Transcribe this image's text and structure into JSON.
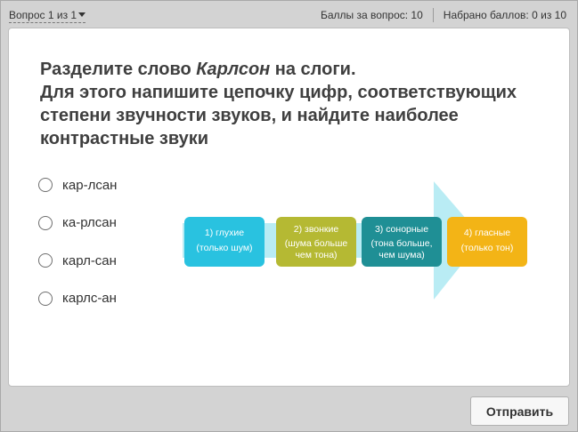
{
  "header": {
    "question_nav": "Вопрос 1 из 1",
    "points_per_question": "Баллы за вопрос: 10",
    "points_scored": "Набрано баллов: 0 из 10"
  },
  "question": {
    "line1_prefix": "Разделите слово ",
    "line1_word": "Карлсон",
    "line1_suffix": " на слоги.",
    "line2": "Для этого напишите цепочку цифр, соответствующих степени звучности звуков, и найдите наиболее контрастные звуки"
  },
  "options": [
    {
      "label": "кар-лсан"
    },
    {
      "label": "ка-рлсан"
    },
    {
      "label": "карл-сан"
    },
    {
      "label": "карлс-ан"
    }
  ],
  "diagram": {
    "boxes": [
      {
        "line1": "1) глухие",
        "line2": "(только шум)",
        "line3": "",
        "color": "#29c2e0"
      },
      {
        "line1": "2) звонкие",
        "line2": "(шума больше",
        "line3": "чем тона)",
        "color": "#b5b933"
      },
      {
        "line1": "3) сонорные",
        "line2": "(тона больше,",
        "line3": "чем шума)",
        "color": "#1f8f95"
      },
      {
        "line1": "4) гласные",
        "line2": "(только тон)",
        "line3": "",
        "color": "#f3b416"
      }
    ],
    "arrow_color": "#b9ecf4"
  },
  "footer": {
    "submit_label": "Отправить"
  }
}
